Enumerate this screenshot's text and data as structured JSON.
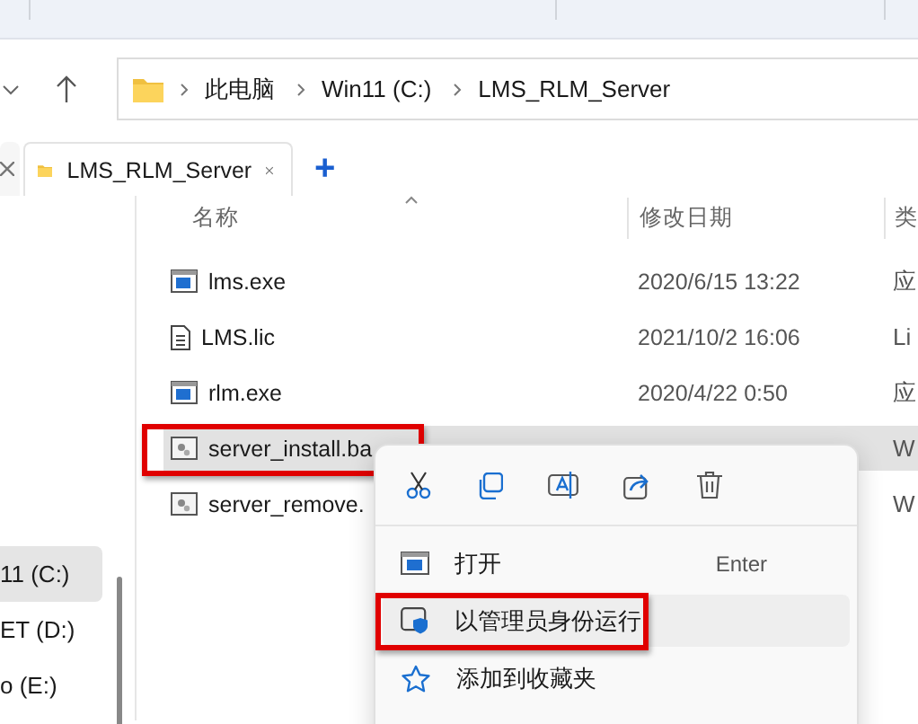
{
  "address_bar": {
    "breadcrumbs": [
      "此电脑",
      "Win11 (C:)",
      "LMS_RLM_Server"
    ]
  },
  "tabs": [
    {
      "label": "LMS_RLM_Server",
      "selected": true
    }
  ],
  "new_tab": "+",
  "sidebar": {
    "items": [
      {
        "label": "11 (C:)",
        "selected": true
      },
      {
        "label": "ET (D:)",
        "selected": false
      },
      {
        "label": "o (E:)",
        "selected": false
      }
    ]
  },
  "columns": [
    "名称",
    "修改日期",
    "类"
  ],
  "files": [
    {
      "name": "lms.exe",
      "kind": "exe",
      "date": "2020/6/15 13:22",
      "type": "应",
      "selected": false,
      "highlighted": false
    },
    {
      "name": "LMS.lic",
      "kind": "doc",
      "date": "2021/10/2 16:06",
      "type": "Li",
      "selected": false,
      "highlighted": false
    },
    {
      "name": "rlm.exe",
      "kind": "exe",
      "date": "2020/4/22 0:50",
      "type": "应",
      "selected": false,
      "highlighted": false
    },
    {
      "name": "server_install.ba",
      "kind": "bat",
      "type": "W",
      "selected": true,
      "highlighted": true
    },
    {
      "name": "server_remove.",
      "kind": "bat",
      "type": "W",
      "selected": false,
      "highlighted": false
    }
  ],
  "context_menu": {
    "items": [
      {
        "label": "打开",
        "kind": "open",
        "shortcut": "Enter",
        "hovered": false,
        "highlighted": false
      },
      {
        "label": "以管理员身份运行",
        "kind": "admin",
        "hovered": true,
        "highlighted": true
      },
      {
        "label": "添加到收藏夹",
        "kind": "favorite",
        "hovered": false,
        "highlighted": false
      }
    ]
  }
}
